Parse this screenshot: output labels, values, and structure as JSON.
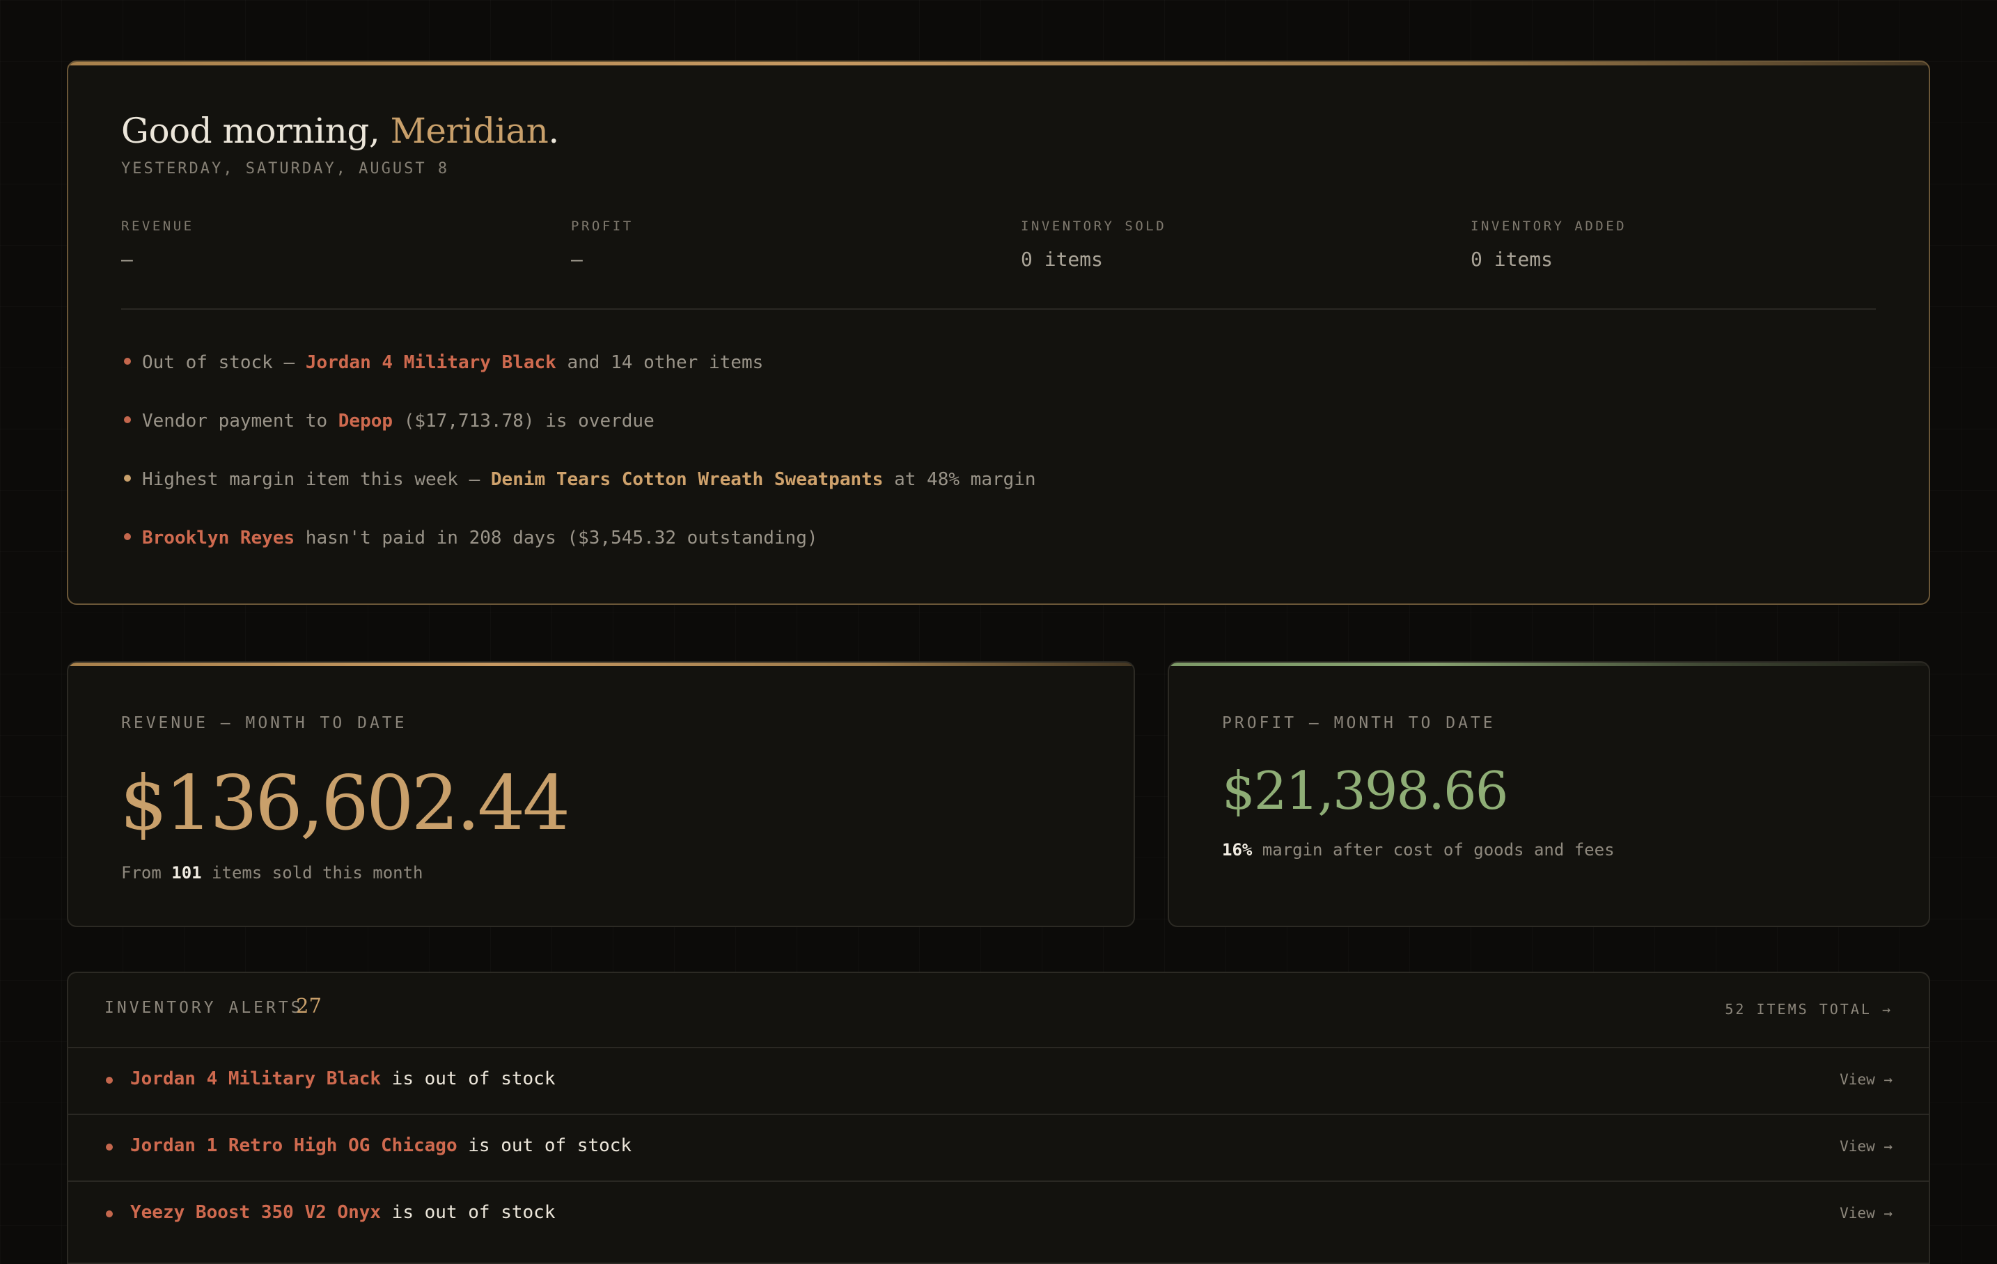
{
  "briefing": {
    "greeting_prefix": "Good morning, ",
    "user_name": "Meridian",
    "greeting_suffix": ".",
    "date": "YESTERDAY, SATURDAY, AUGUST 8",
    "stats": [
      {
        "label": "REVENUE",
        "value": "—"
      },
      {
        "label": "PROFIT",
        "value": "—"
      },
      {
        "label": "INVENTORY SOLD",
        "value": "0 items"
      },
      {
        "label": "INVENTORY ADDED",
        "value": "0 items"
      }
    ],
    "insights": [
      {
        "pre": "Out of stock — ",
        "highlight": "Jordan 4 Military Black",
        "post": " and 14 other items",
        "tone": "red"
      },
      {
        "pre": "Vendor payment to ",
        "highlight": "Depop",
        "post": " ($17,713.78) is overdue",
        "tone": "red"
      },
      {
        "pre": "Highest margin item this week — ",
        "highlight": "Denim Tears Cotton Wreath Sweatpants",
        "post": " at 48% margin",
        "tone": "gold"
      },
      {
        "pre": "",
        "highlight": "Brooklyn Reyes",
        "post": " hasn't paid in 208 days ($3,545.32 outstanding)",
        "tone": "red"
      }
    ]
  },
  "revenue_mtd": {
    "label": "REVENUE — MONTH TO DATE",
    "value": "$136,602.44",
    "sub_pre": "From ",
    "sub_strong": "101",
    "sub_post": " items sold this month"
  },
  "profit_mtd": {
    "label": "PROFIT — MONTH TO DATE",
    "value": "$21,398.66",
    "sub_strong": "16%",
    "sub_post": " margin after cost of goods and fees"
  },
  "inventory_alerts": {
    "title": "INVENTORY ALERTS",
    "count": "27",
    "total_link": "52 ITEMS TOTAL →",
    "rows": [
      {
        "item": "Jordan 4 Military Black",
        "status": " is out of stock",
        "action": "View →"
      },
      {
        "item": "Jordan 1 Retro High OG Chicago",
        "status": " is out of stock",
        "action": "View →"
      },
      {
        "item": "Yeezy Boost 350 V2 Onyx",
        "status": " is out of stock",
        "action": "View →"
      }
    ]
  },
  "colors": {
    "background": "#0c0b09",
    "card": "#13120e",
    "gold_accent": "#c9a06b",
    "green_accent": "#8fae76",
    "alert_red": "#cf6a4f"
  }
}
